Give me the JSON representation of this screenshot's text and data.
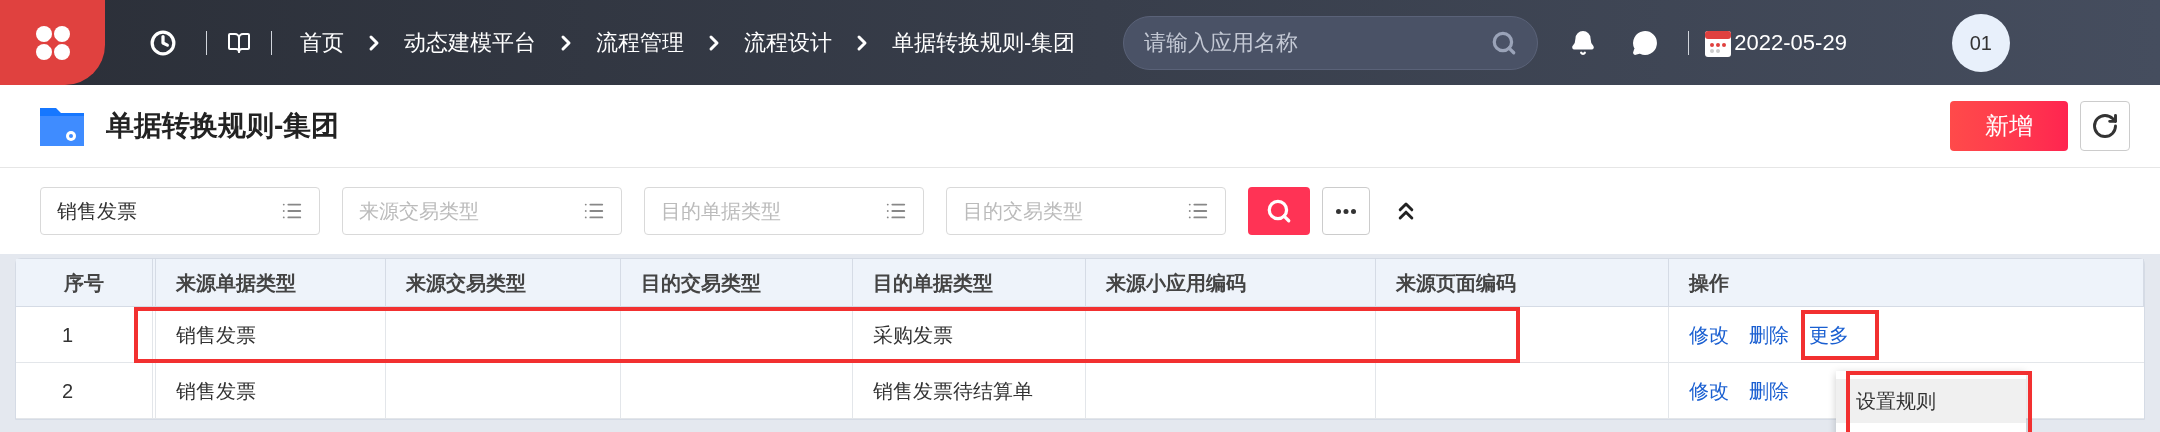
{
  "top_bar": {
    "breadcrumb": [
      "首页",
      "动态建模平台",
      "流程管理",
      "流程设计",
      "单据转换规则-集团"
    ],
    "search": {
      "placeholder": "请输入应用名称"
    },
    "date": "2022-05-29",
    "avatar": "01"
  },
  "page": {
    "title": "单据转换规则-集团",
    "add_button": "新增"
  },
  "filters": [
    {
      "value": "销售发票"
    },
    {
      "placeholder": "来源交易类型"
    },
    {
      "placeholder": "目的单据类型"
    },
    {
      "placeholder": "目的交易类型"
    }
  ],
  "table": {
    "columns": [
      "序号",
      "来源单据类型",
      "来源交易类型",
      "目的交易类型",
      "目的单据类型",
      "来源小应用编码",
      "来源页面编码",
      "操作"
    ],
    "rows": [
      {
        "annotated": true,
        "cells": [
          "1",
          "销售发票",
          "",
          "",
          "采购发票",
          "",
          ""
        ],
        "actions": [
          {
            "label": "修改",
            "annotated": false
          },
          {
            "label": "删除",
            "annotated": false
          },
          {
            "label": "更多",
            "annotated": true
          }
        ]
      },
      {
        "annotated": false,
        "cells": [
          "2",
          "销售发票",
          "",
          "",
          "销售发票待结算单",
          "",
          ""
        ],
        "actions": [
          {
            "label": "修改",
            "annotated": false
          },
          {
            "label": "删除",
            "annotated": false
          }
        ]
      }
    ]
  },
  "dropdown": {
    "annotated": true,
    "items": [
      "设置规则"
    ]
  }
}
